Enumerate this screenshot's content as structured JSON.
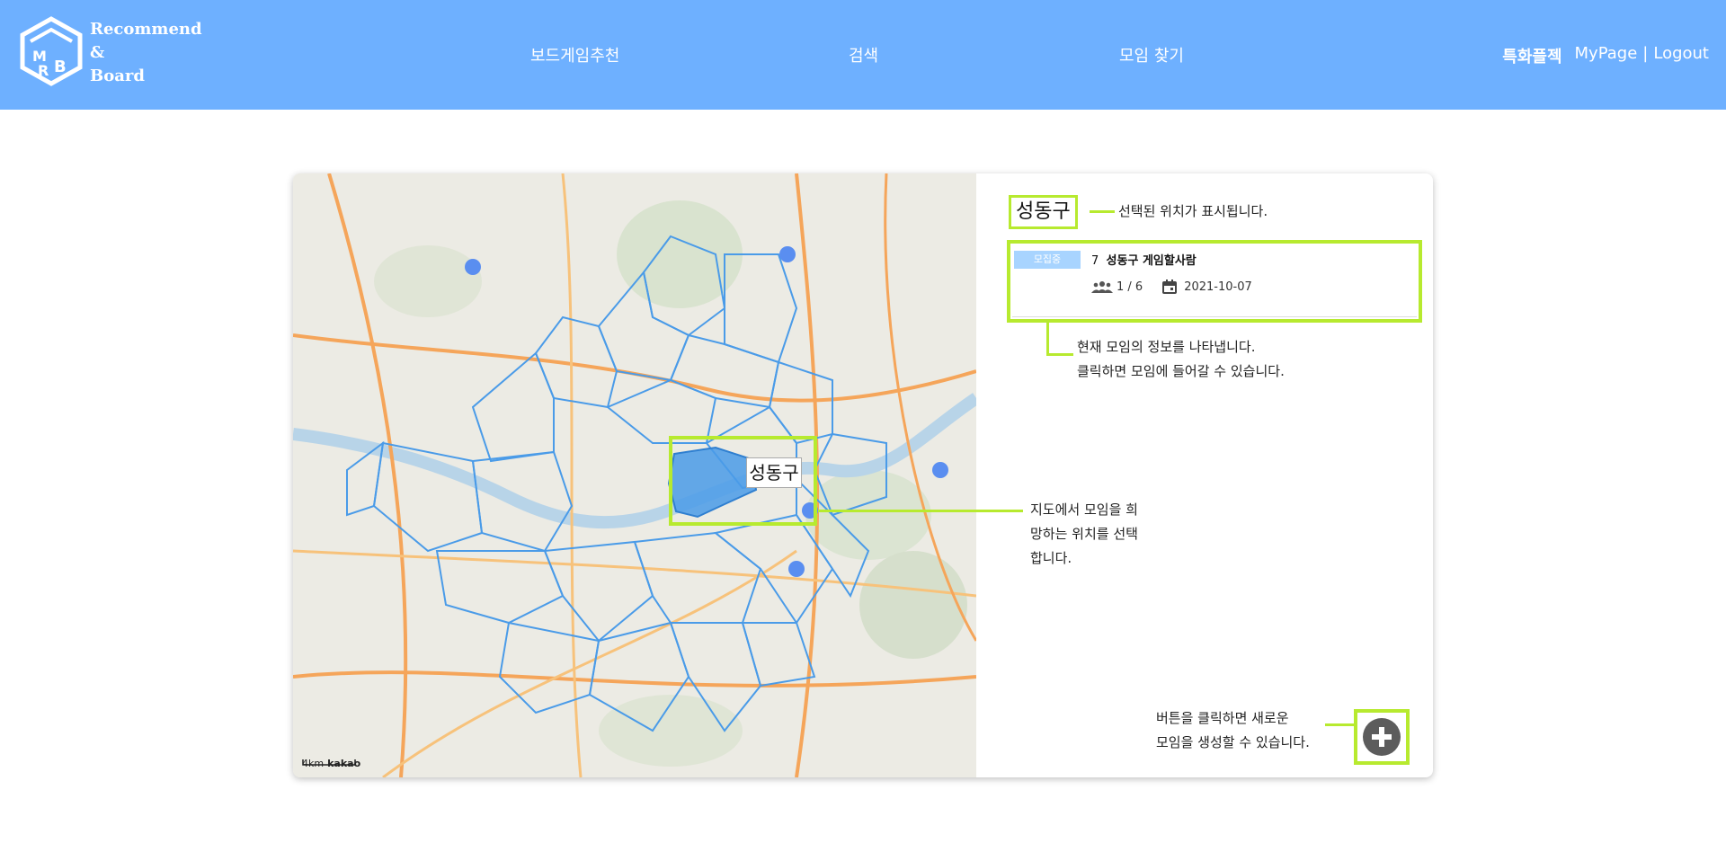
{
  "header": {
    "logo_lines": [
      "Recommend",
      "&",
      "Board"
    ],
    "nav": {
      "board_recommend": "보드게임추천",
      "search": "검색",
      "find_meeting": "모임 찾기",
      "special": "특화플젝",
      "mypage": "MyPage",
      "separator": "|",
      "logout": "Logout"
    }
  },
  "map": {
    "selected_label": "성동구",
    "scale": "4km",
    "brand": "kakao"
  },
  "panel": {
    "selected_location": "성동구",
    "location_note": "선택된 위치가 표시됩니다.",
    "meeting": {
      "badge": "모집중",
      "number": "7",
      "title": "성동구 게임할사람",
      "members": "1 / 6",
      "date": "2021-10-07"
    },
    "meeting_note_line1": "현재 모임의 정보를 나타냅니다.",
    "meeting_note_line2": "클릭하면 모임에 들어갈 수 있습니다.",
    "map_note_line1": "지도에서 모임을 희",
    "map_note_line2": "망하는 위치를 선택",
    "map_note_line3": "합니다.",
    "add_note_line1": "버튼을 클릭하면 새로운",
    "add_note_line2": "모임을 생성할 수 있습니다."
  },
  "colors": {
    "header_bg": "#6eb0ff",
    "highlight": "#b7ea2f",
    "badge_bg": "#a8d4ff",
    "district_border": "#4a9be8",
    "selected_district": "#4a9be8"
  },
  "icons": [
    "logo-icon",
    "members-icon",
    "calendar-icon",
    "plus-icon"
  ]
}
